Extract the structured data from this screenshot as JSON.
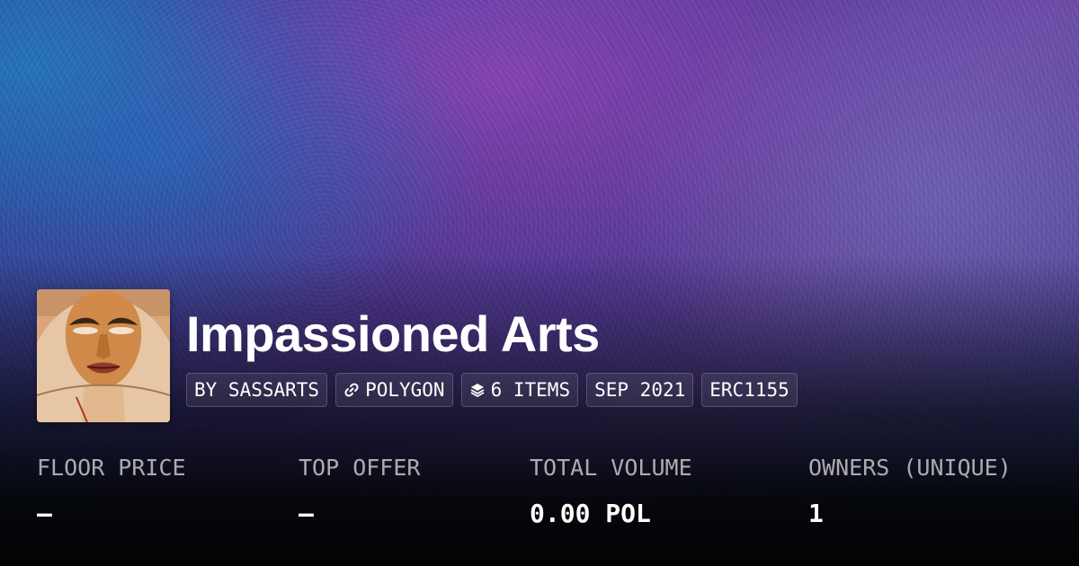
{
  "collection": {
    "name": "Impassioned Arts",
    "chips": {
      "creator": "BY SASSARTS",
      "chain": "POLYGON",
      "items": "6 ITEMS",
      "created": "SEP 2021",
      "standard": "ERC1155"
    }
  },
  "stats": {
    "floor_price": {
      "label": "FLOOR PRICE",
      "value": "–"
    },
    "top_offer": {
      "label": "TOP OFFER",
      "value": "–"
    },
    "total_volume": {
      "label": "TOTAL VOLUME",
      "value": "0.00 POL"
    },
    "owners": {
      "label": "OWNERS (UNIQUE)",
      "value": "1"
    }
  },
  "icons": {
    "chain": "link-icon",
    "items": "layers-icon"
  },
  "colors": {
    "banner_primary": "#6d4aa8",
    "banner_secondary": "#2a4fa8",
    "background_dark": "#030405"
  }
}
